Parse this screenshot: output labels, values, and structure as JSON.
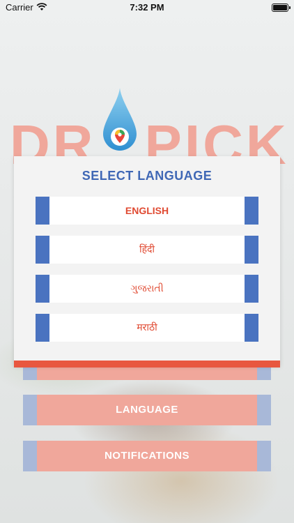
{
  "status_bar": {
    "carrier": "Carrier",
    "time": "7:32 PM"
  },
  "logo": {
    "left_text": "DR",
    "right_text": "PICK",
    "color": "#f0a79b"
  },
  "language_dialog": {
    "title": "SELECT LANGUAGE",
    "options": [
      {
        "label": "ENGLISH",
        "selected": true
      },
      {
        "label": "हिंदी",
        "selected": false
      },
      {
        "label": "ગુજરાતી",
        "selected": false
      },
      {
        "label": "मराठी",
        "selected": false
      }
    ],
    "accent_color": "#e8573f",
    "edge_color": "#4a73c0"
  },
  "menu": {
    "language_label": "LANGUAGE",
    "notifications_label": "NOTIFICATIONS"
  }
}
